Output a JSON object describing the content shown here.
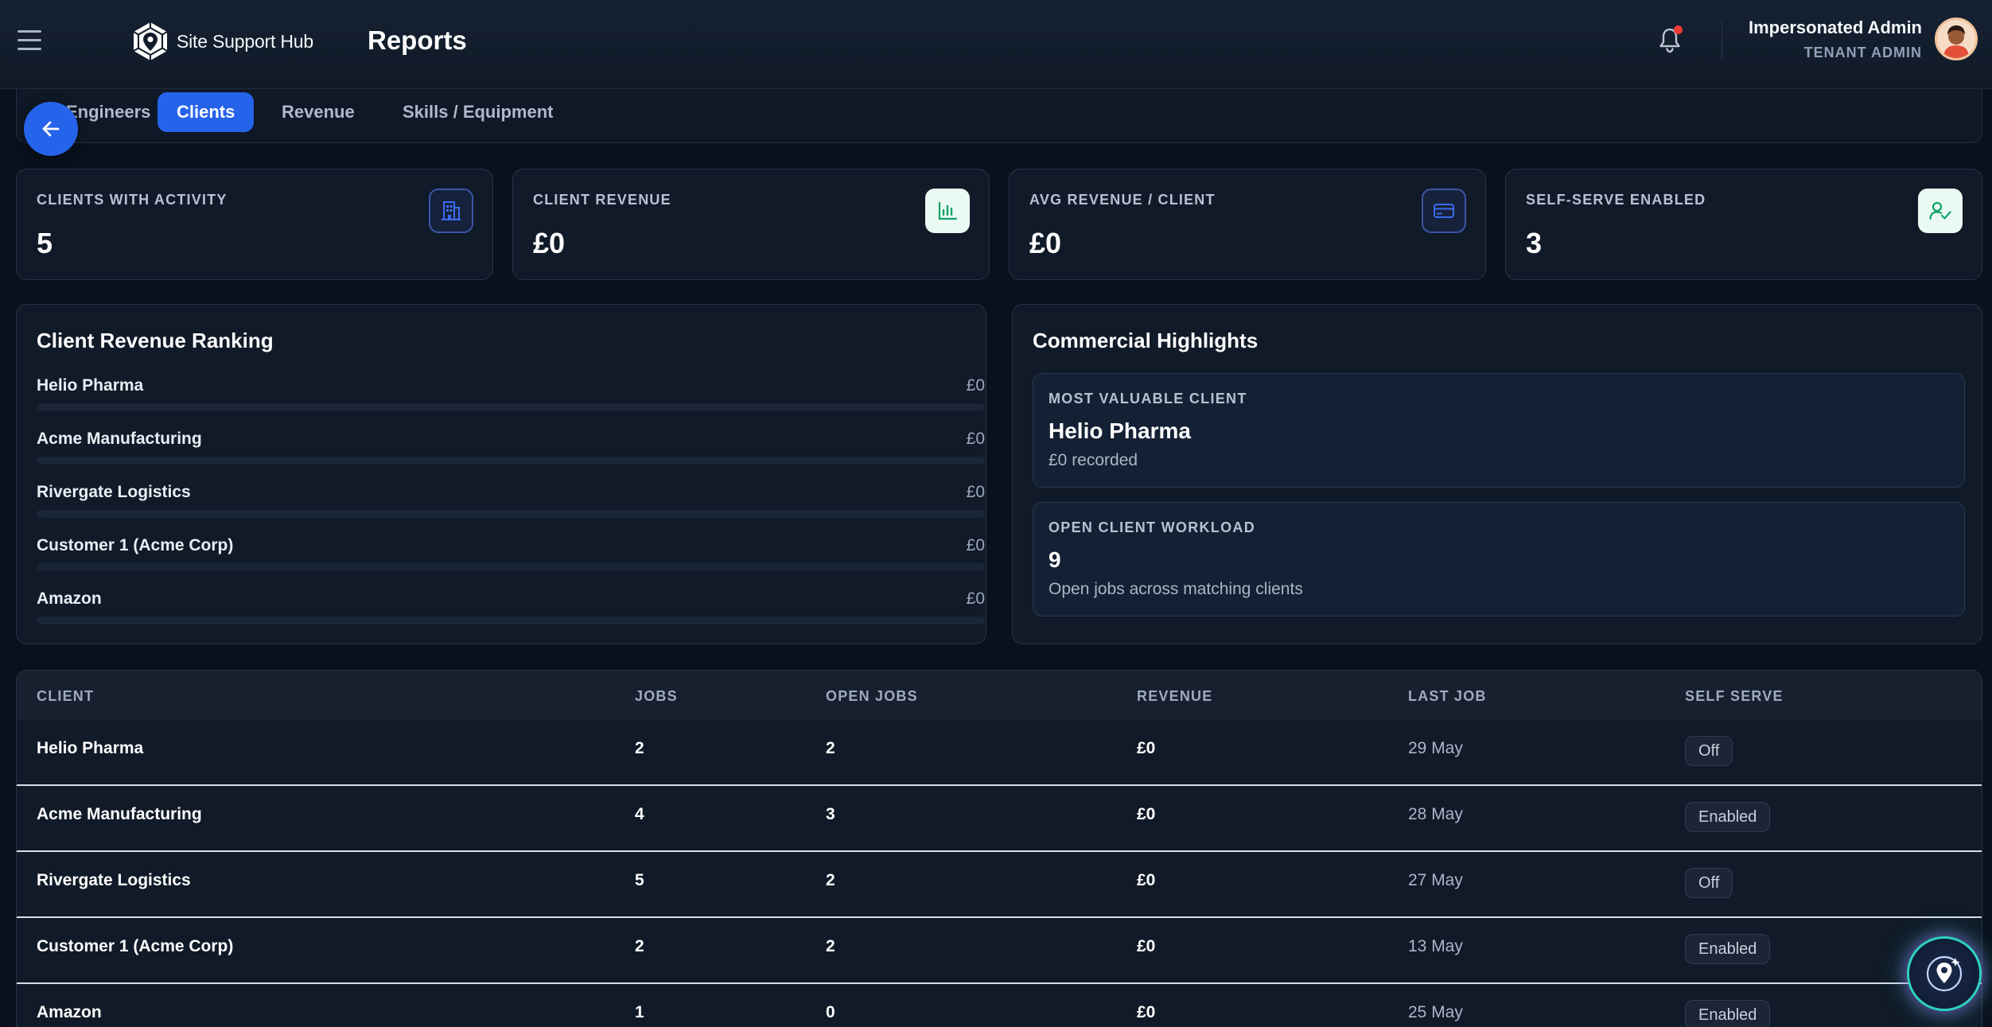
{
  "header": {
    "brand_name": "Site Support Hub",
    "page_title": "Reports",
    "notification_dot_color": "#ef3a3a",
    "user": {
      "name": "Impersonated Admin",
      "role": "TENANT ADMIN"
    }
  },
  "tabs": [
    {
      "label": "Engineers",
      "active": false
    },
    {
      "label": "Clients",
      "active": true
    },
    {
      "label": "Revenue",
      "active": false
    },
    {
      "label": "Skills / Equipment",
      "active": false
    }
  ],
  "kpis": [
    {
      "label": "CLIENTS WITH ACTIVITY",
      "value": "5",
      "icon": "building-icon"
    },
    {
      "label": "CLIENT REVENUE",
      "value": "£0",
      "icon": "bar-chart-icon"
    },
    {
      "label": "AVG REVENUE / CLIENT",
      "value": "£0",
      "icon": "credit-card-icon"
    },
    {
      "label": "SELF-SERVE ENABLED",
      "value": "3",
      "icon": "user-check-icon"
    }
  ],
  "ranking": {
    "title": "Client Revenue Ranking",
    "items": [
      {
        "name": "Helio Pharma",
        "value": "£0",
        "share": 0
      },
      {
        "name": "Acme Manufacturing",
        "value": "£0",
        "share": 0
      },
      {
        "name": "Rivergate Logistics",
        "value": "£0",
        "share": 0
      },
      {
        "name": "Customer 1 (Acme Corp)",
        "value": "£0",
        "share": 0
      },
      {
        "name": "Amazon",
        "value": "£0",
        "share": 0
      }
    ]
  },
  "highlights": {
    "title": "Commercial Highlights",
    "cards": [
      {
        "label": "MOST VALUABLE CLIENT",
        "value": "Helio Pharma",
        "sub": "£0 recorded"
      },
      {
        "label": "OPEN CLIENT WORKLOAD",
        "value": "9",
        "sub": "Open jobs across matching clients"
      }
    ]
  },
  "table": {
    "headers": [
      "CLIENT",
      "JOBS",
      "OPEN JOBS",
      "REVENUE",
      "LAST JOB",
      "SELF SERVE"
    ],
    "rows": [
      {
        "client": "Helio Pharma",
        "jobs": "2",
        "open_jobs": "2",
        "revenue": "£0",
        "last_job": "29 May",
        "self_serve": "Off"
      },
      {
        "client": "Acme Manufacturing",
        "jobs": "4",
        "open_jobs": "3",
        "revenue": "£0",
        "last_job": "28 May",
        "self_serve": "Enabled"
      },
      {
        "client": "Rivergate Logistics",
        "jobs": "5",
        "open_jobs": "2",
        "revenue": "£0",
        "last_job": "27 May",
        "self_serve": "Off"
      },
      {
        "client": "Customer 1 (Acme Corp)",
        "jobs": "2",
        "open_jobs": "2",
        "revenue": "£0",
        "last_job": "13 May",
        "self_serve": "Enabled"
      },
      {
        "client": "Amazon",
        "jobs": "1",
        "open_jobs": "0",
        "revenue": "£0",
        "last_job": "25 May",
        "self_serve": "Enabled"
      }
    ]
  },
  "colors": {
    "accent": "#2563eb",
    "background": "#0a111d",
    "card": "#111a28",
    "success_icon_bg": "#eafaf3",
    "success_icon": "#10a36b"
  }
}
